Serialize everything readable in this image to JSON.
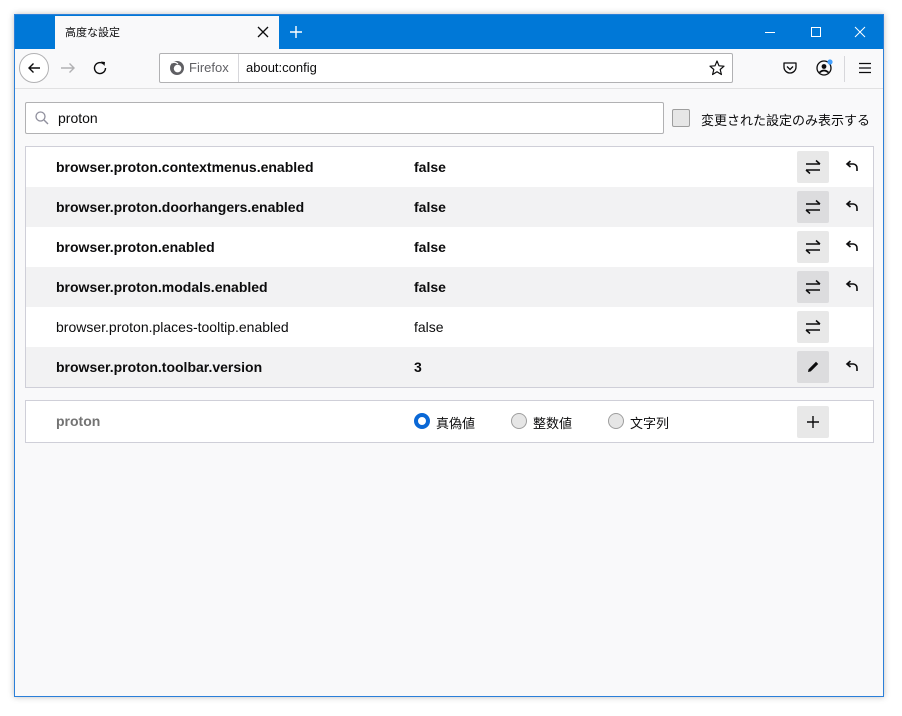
{
  "tab": {
    "title": "高度な設定"
  },
  "urlbar": {
    "identity_label": "Firefox",
    "url": "about:config"
  },
  "search": {
    "value": "proton"
  },
  "modified_only": {
    "label": "変更された設定のみ表示する",
    "checked": false
  },
  "prefs": [
    {
      "name": "browser.proton.contextmenus.enabled",
      "value": "false",
      "modified": true,
      "action": "toggle"
    },
    {
      "name": "browser.proton.doorhangers.enabled",
      "value": "false",
      "modified": true,
      "action": "toggle"
    },
    {
      "name": "browser.proton.enabled",
      "value": "false",
      "modified": true,
      "action": "toggle"
    },
    {
      "name": "browser.proton.modals.enabled",
      "value": "false",
      "modified": true,
      "action": "toggle"
    },
    {
      "name": "browser.proton.places-tooltip.enabled",
      "value": "false",
      "modified": false,
      "action": "toggle"
    },
    {
      "name": "browser.proton.toolbar.version",
      "value": "3",
      "modified": true,
      "action": "edit"
    }
  ],
  "add_row": {
    "name": "proton",
    "types": [
      {
        "label": "真偽値",
        "selected": true
      },
      {
        "label": "整数値",
        "selected": false
      },
      {
        "label": "文字列",
        "selected": false
      }
    ]
  },
  "colors": {
    "titlebar": "#0078d7",
    "radio_selected": "#0a68d6"
  }
}
